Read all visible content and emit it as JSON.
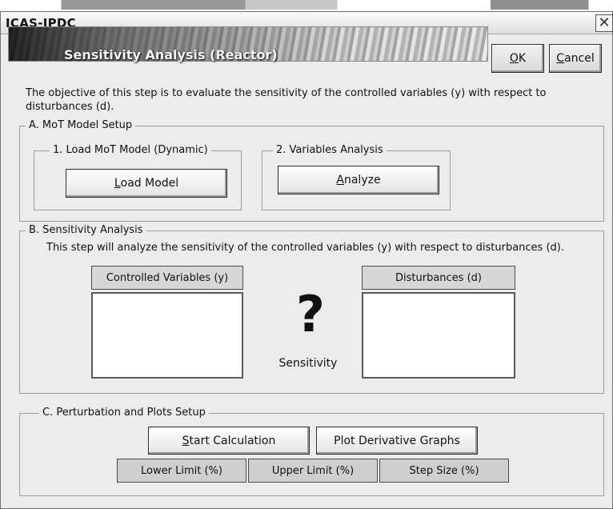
{
  "window": {
    "title": "ICAS-IPDC",
    "close_glyph": "✕",
    "banner_title": "Sensitivity Analysis (Reactor)"
  },
  "header_buttons": {
    "ok": {
      "label": "OK",
      "accel": "O",
      "rest": "K"
    },
    "cancel": {
      "label": "Cancel",
      "accel": "C",
      "rest": "ancel"
    }
  },
  "objective_text": "The objective of this step is to evaluate the sensitivity of the controlled variables (y)  with respect to disturbances (d).",
  "section_a": {
    "title": "A. MoT Model Setup",
    "sub1": {
      "title": "1. Load MoT Model (Dynamic)",
      "button": {
        "label": "Load Model",
        "accel": "L",
        "rest": "oad Model"
      }
    },
    "sub2": {
      "title": "2. Variables Analysis",
      "button": {
        "label": "Analyze",
        "accel": "A",
        "rest": "nalyze"
      }
    }
  },
  "section_b": {
    "title": "B. Sensitivity Analysis",
    "description": "This step will analyze the sensitivity of the controlled variables (y) with respect to disturbances (d).",
    "controlled_header": "Controlled Variables (y)",
    "disturbances_header": "Disturbances (d)",
    "question_mark": "?",
    "center_label": "Sensitivity"
  },
  "section_c": {
    "title": "C. Perturbation and Plots Setup",
    "start_button": {
      "label": "Start Calculation",
      "accel": "S",
      "rest": "tart Calculation"
    },
    "plot_button": {
      "label": "Plot Derivative Graphs"
    },
    "limits": [
      "Lower Limit (%)",
      "Upper Limit (%)",
      "Step Size (%)"
    ]
  },
  "icons": {
    "close": "close-icon",
    "banner": "banner-image-icon"
  }
}
